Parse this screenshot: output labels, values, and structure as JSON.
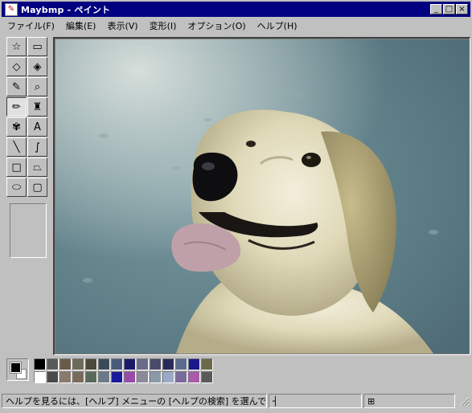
{
  "window": {
    "title": "Maybmp - ペイント",
    "controls": {
      "minimize": "_",
      "maximize": "□",
      "close": "×"
    }
  },
  "menu": [
    {
      "label": "ファイル(F)"
    },
    {
      "label": "編集(E)"
    },
    {
      "label": "表示(V)"
    },
    {
      "label": "変形(I)"
    },
    {
      "label": "オプション(O)"
    },
    {
      "label": "ヘルプ(H)"
    }
  ],
  "tools": [
    {
      "name": "free-form-select",
      "icon": "☆"
    },
    {
      "name": "rect-select",
      "icon": "▭"
    },
    {
      "name": "eraser",
      "icon": "◇"
    },
    {
      "name": "fill",
      "icon": "◈"
    },
    {
      "name": "color-picker",
      "icon": "✎"
    },
    {
      "name": "magnifier",
      "icon": "⌕"
    },
    {
      "name": "pencil",
      "icon": "✏"
    },
    {
      "name": "brush",
      "icon": "♜"
    },
    {
      "name": "airbrush",
      "icon": "✾"
    },
    {
      "name": "text",
      "icon": "A"
    },
    {
      "name": "line",
      "icon": "╲"
    },
    {
      "name": "curve",
      "icon": "∫"
    },
    {
      "name": "rectangle",
      "icon": "□"
    },
    {
      "name": "polygon",
      "icon": "⏢"
    },
    {
      "name": "ellipse",
      "icon": "⬭"
    },
    {
      "name": "rounded-rect",
      "icon": "▢"
    }
  ],
  "active_tool": "pencil",
  "palette": {
    "foreground": "#000000",
    "background": "#ffffff",
    "colors": [
      "#000000",
      "#5a5a5a",
      "#6b5a4a",
      "#6b6b5a",
      "#4a4a3a",
      "#3a4a5a",
      "#4a5a7a",
      "#1a1a6a",
      "#6a6a8a",
      "#4a4a6a",
      "#2a2a5a",
      "#5a6a8a",
      "#1a1a8a",
      "#6a6a4a",
      "#ffffff",
      "#4a4a4a",
      "#8a7a6a",
      "#7a6a5a",
      "#5a6a5a",
      "#6a7a8a",
      "#1a1a9a",
      "#9a4aaa",
      "#8a8a9a",
      "#8a9aaa",
      "#9aaaca",
      "#7a6a9a",
      "#aa5aaa",
      "#5a5a5a"
    ]
  },
  "status": {
    "help_text": "ヘルプを見るには、[ヘルプ] メニューの [ヘルプの検索] を選んでください。",
    "position_text": "",
    "size_text": "",
    "position_icon": "┤",
    "size_icon": "⊞"
  }
}
